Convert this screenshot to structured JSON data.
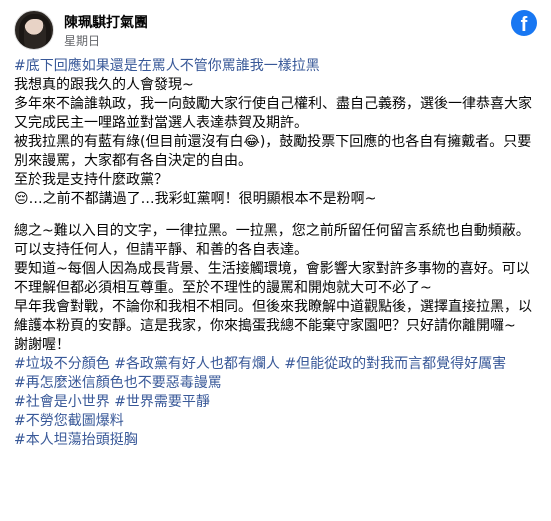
{
  "post": {
    "author": "陳珮騏打氣團",
    "time": "星期日",
    "platform_icon": "facebook-icon",
    "paragraph1": [
      {
        "text": "#底下回應如果還是在罵人不管你罵誰我一樣拉黑",
        "tag": true
      },
      {
        "text": "我想真的跟我久的人會發現~",
        "tag": false
      },
      {
        "text": "多年來不論誰執政，我一向鼓勵大家行使自己權利、盡自己義務，選後一律恭喜大家又完成民主一哩路並對當選人表達恭賀及期許。",
        "tag": false
      },
      {
        "text": "被我拉黑的有藍有綠(但目前還沒有白😂)，鼓勵投票下回應的也各自有擁戴者。只要別來謾罵，大家都有各自決定的自由。",
        "tag": false
      },
      {
        "text": "至於我是支持什麼政黨？",
        "tag": false
      },
      {
        "text": "😔…之前不都講過了…我彩虹黨啊！很明顯根本不是粉啊~",
        "tag": false
      }
    ],
    "paragraph2": [
      {
        "text": "總之~難以入目的文字，一律拉黑。一拉黑，您之前所留任何留言系統也自動頻蔽。",
        "tag": false
      },
      {
        "text": "可以支持任何人，但請平靜、和善的各自表達。",
        "tag": false
      },
      {
        "text": "要知道~每個人因為成長背景、生活接觸環境，會影響大家對許多事物的喜好。可以不理解但都必須相互尊重。至於不理性的謾罵和開炮就大可不必了~",
        "tag": false
      },
      {
        "text": "早年我會對戰，不論你和我相不相同。但後來我瞭解中道觀點後，選擇直接拉黑，以維護本粉頁的安靜。這是我家，你來搗蛋我總不能棄守家園吧？只好請你離開囉~",
        "tag": false
      },
      {
        "text": "謝謝喔！",
        "tag": false
      }
    ],
    "hashtags": [
      [
        "#垃圾不分顏色",
        "#各政黨有好人也都有爛人",
        "#但能從政的對我而言都覺得好厲害"
      ],
      [
        "#再怎麼迷信顏色也不要惡毒謾罵"
      ],
      [
        "#社會是小世界",
        "#世界需要平靜"
      ],
      [
        "#不勞您截圖爆料"
      ],
      [
        "#本人坦蕩抬頭挺胸"
      ]
    ]
  }
}
